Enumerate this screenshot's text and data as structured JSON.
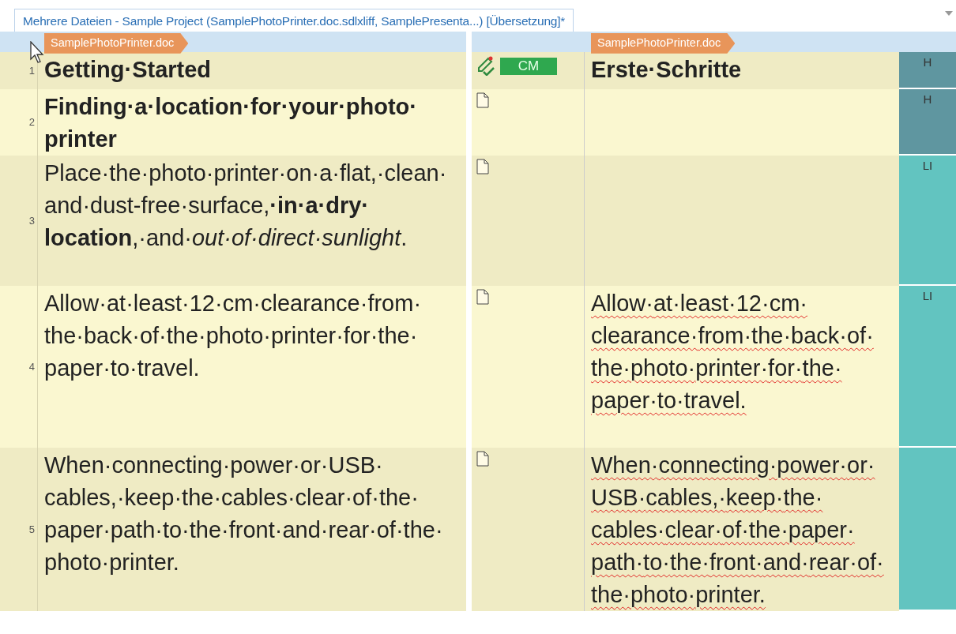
{
  "tab": {
    "title": "Mehrere Dateien - Sample Project (SamplePhotoPrinter.doc.sdlxliff, SamplePresenta...) [Übersetzung]*",
    "selected": true
  },
  "file_header": {
    "source_file": "SamplePhotoPrinter.doc",
    "target_file": "SamplePhotoPrinter.doc"
  },
  "rows": [
    {
      "number": "1",
      "source": "Getting·Started",
      "bold": true,
      "kind": "edited",
      "match": "CM",
      "target": "Erste·Schritte",
      "spelling_error": false,
      "style": "H",
      "color": "#5f96a0"
    },
    {
      "number": "2",
      "source": "Finding·a·location·for·your·photo·printer",
      "bold": true,
      "kind": "empty",
      "style": "H",
      "color": "#5f96a0"
    },
    {
      "number": "3",
      "source": "Place·the·photo·printer·on·a·flat,·clean·and·dust-free·surface,**·in·a·dry·location**,·and·*out·of·direct·sunlight*.",
      "bold": false,
      "kind": "empty",
      "style": "LI",
      "color": "#62c4c0"
    },
    {
      "number": "4",
      "source": "Allow·at·least·12·cm·clearance·from·the·back·of·the·photo·printer·for·the·paper·to·travel.",
      "bold": false,
      "kind": "empty",
      "target": "Allow·at·least·12·cm·clearance·from·the·back·of·the·photo·printer·for·the·paper·to·travel.",
      "spelling_error": true,
      "style": "LI",
      "color": "#62c4c0"
    },
    {
      "number": "5",
      "source": "When·connecting·power·or·USB·cables,·keep·the·cables·clear·of·the·paper·path·to·the·front·and·rear·of·the·photo·printer.",
      "bold": false,
      "kind": "empty",
      "target": "When·connecting·power·or·USB·cables,·keep·the·cables·clear·of·the·paper·path·to·the·front·and·rear·of·the·photo·printer.",
      "spelling_error": true,
      "color": "#62c4c0"
    }
  ]
}
